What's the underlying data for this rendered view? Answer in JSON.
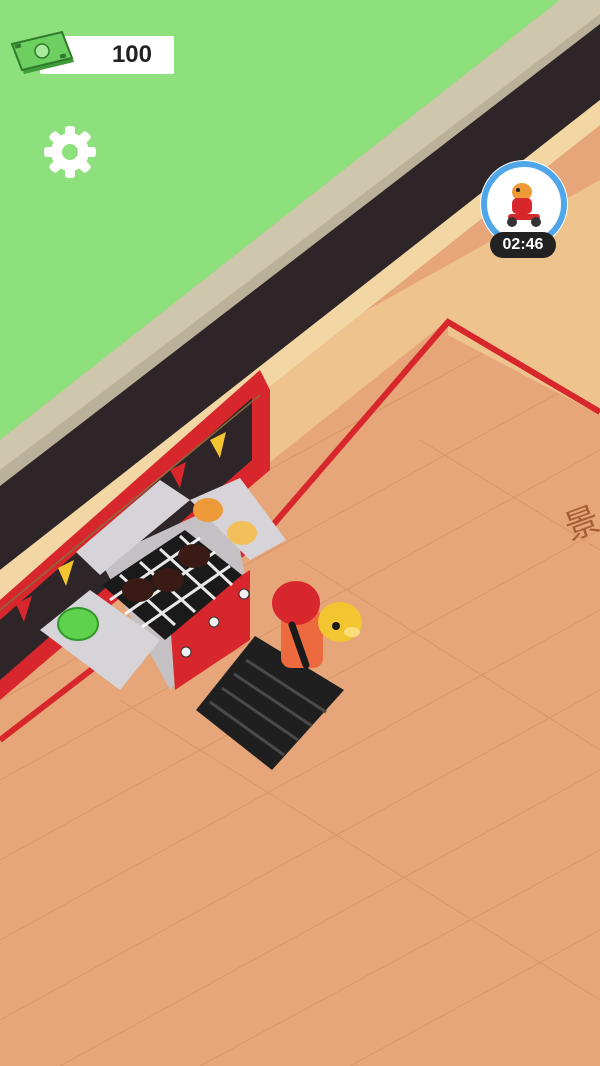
{
  "hud": {
    "money": "100",
    "timer": "02:46"
  },
  "icons": {
    "money": "cash-stack-icon",
    "settings": "gear-icon",
    "bonus": "dinosaur-scooter-icon"
  },
  "colors": {
    "grass": "#8ee07c",
    "road": "#2d2527",
    "floor": "#e7a679",
    "wall": "#eec38e",
    "trim": "#d8272c",
    "timer_ring": "#4fa6e8"
  }
}
